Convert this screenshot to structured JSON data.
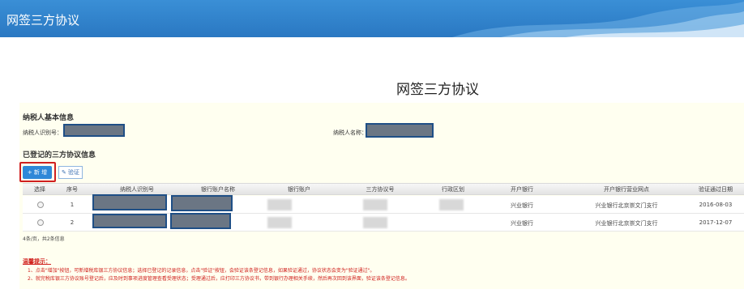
{
  "header": {
    "title": "网签三方协议"
  },
  "page": {
    "title": "网签三方协议"
  },
  "taxpayer_section": {
    "title": "纳税人基本信息",
    "id_label": "纳税人识别号：",
    "name_label": "纳税人名称："
  },
  "registered_section": {
    "title": "已登记的三方协议信息",
    "add_button": "+ 新 增",
    "verify_button": "验证"
  },
  "table": {
    "columns": [
      "选择",
      "序号",
      "纳税人识别号",
      "银行账户名称",
      "银行账户",
      "三方协议号",
      "行政区划",
      "开户银行",
      "开户银行营业网点",
      "验证通过日期"
    ],
    "rows": [
      {
        "seq": "1",
        "bank": "兴业银行",
        "branch": "兴业银行北京崇文门支行",
        "date": "2016-08-03"
      },
      {
        "seq": "2",
        "bank": "兴业银行",
        "branch": "兴业银行北京崇文门支行",
        "date": "2017-12-07"
      }
    ]
  },
  "paging": {
    "text": "4条/页，共2条信息"
  },
  "tips": {
    "title": "温馨提示：",
    "lines": [
      "1、点击\"增加\"按钮，可新增税库银三方协议信息；选择已登记的记录信息，点击\"验证\"按钮，会验证该条登记信息，如果验证通过，协议状态会变为\"验证通过\"。",
      "2、就完税库银三方协议账号登记后，应及时到事项进度管理查看受理状态；受理通过后，应打印三方协议书，带到银行办理相关手续，然后再次回到该界面，验证该条登记信息。"
    ]
  }
}
